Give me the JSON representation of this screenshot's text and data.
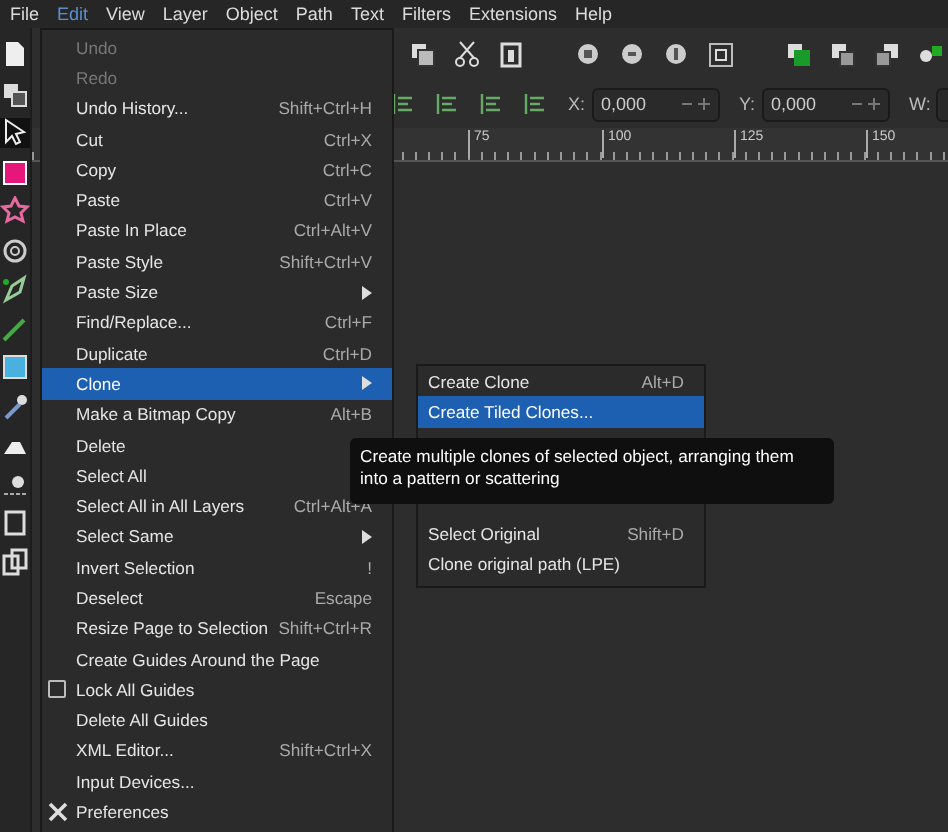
{
  "menubar": [
    {
      "label": "File",
      "selected": false
    },
    {
      "label": "Edit",
      "selected": true
    },
    {
      "label": "View",
      "selected": false
    },
    {
      "label": "Layer",
      "selected": false
    },
    {
      "label": "Object",
      "selected": false
    },
    {
      "label": "Path",
      "selected": false
    },
    {
      "label": "Text",
      "selected": false
    },
    {
      "label": "Filters",
      "selected": false
    },
    {
      "label": "Extensions",
      "selected": false
    },
    {
      "label": "Help",
      "selected": false
    }
  ],
  "controls_bar": {
    "fields": [
      {
        "label": "X:",
        "value": "0,000"
      },
      {
        "label": "Y:",
        "value": "0,000"
      },
      {
        "label": "W:"
      }
    ]
  },
  "ruler": {
    "labels": [
      "75",
      "100",
      "125",
      "150"
    ]
  },
  "edit_menu": {
    "items": [
      {
        "kind": "item",
        "label": "Undo",
        "disabled": true,
        "selected": false
      },
      {
        "kind": "item",
        "label": "Redo",
        "disabled": true,
        "selected": false
      },
      {
        "kind": "item",
        "label": "Undo History...",
        "shortcut": "Shift+Ctrl+H",
        "disabled": false,
        "selected": false
      },
      {
        "kind": "item",
        "label": "Cut",
        "shortcut": "Ctrl+X",
        "disabled": false,
        "selected": false
      },
      {
        "kind": "item",
        "label": "Copy",
        "shortcut": "Ctrl+C",
        "disabled": false,
        "selected": false
      },
      {
        "kind": "item",
        "label": "Paste",
        "shortcut": "Ctrl+V",
        "disabled": false,
        "selected": false
      },
      {
        "kind": "item",
        "label": "Paste In Place",
        "shortcut": "Ctrl+Alt+V",
        "disabled": false,
        "selected": false
      },
      {
        "kind": "item",
        "label": "Paste Style",
        "shortcut": "Shift+Ctrl+V",
        "disabled": false,
        "selected": false
      },
      {
        "kind": "submenu",
        "label": "Paste Size",
        "disabled": false,
        "selected": false
      },
      {
        "kind": "item",
        "label": "Find/Replace...",
        "shortcut": "Ctrl+F",
        "disabled": false,
        "selected": false
      },
      {
        "kind": "item",
        "label": "Duplicate",
        "shortcut": "Ctrl+D",
        "disabled": false,
        "selected": false
      },
      {
        "kind": "submenu",
        "label": "Clone",
        "disabled": false,
        "selected": true
      },
      {
        "kind": "item",
        "label": "Make a Bitmap Copy",
        "shortcut": "Alt+B",
        "disabled": false,
        "selected": false
      },
      {
        "kind": "item",
        "label": "Delete",
        "disabled": false,
        "selected": false
      },
      {
        "kind": "item",
        "label": "Select All",
        "disabled": false,
        "selected": false
      },
      {
        "kind": "item",
        "label": "Select All in All Layers",
        "shortcut": "Ctrl+Alt+A",
        "disabled": false,
        "selected": false
      },
      {
        "kind": "submenu",
        "label": "Select Same",
        "disabled": false,
        "selected": false
      },
      {
        "kind": "item",
        "label": "Invert Selection",
        "shortcut": "!",
        "disabled": false,
        "selected": false
      },
      {
        "kind": "item",
        "label": "Deselect",
        "shortcut": "Escape",
        "disabled": false,
        "selected": false
      },
      {
        "kind": "item",
        "label": "Resize Page to Selection",
        "shortcut": "Shift+Ctrl+R",
        "disabled": false,
        "selected": false
      },
      {
        "kind": "item",
        "label": "Create Guides Around the Page",
        "disabled": false,
        "selected": false
      },
      {
        "kind": "check",
        "label": "Lock All Guides",
        "checked": false,
        "disabled": false,
        "selected": false
      },
      {
        "kind": "item",
        "label": "Delete All Guides",
        "disabled": false,
        "selected": false
      },
      {
        "kind": "item",
        "label": "XML Editor...",
        "shortcut": "Shift+Ctrl+X",
        "disabled": false,
        "selected": false
      },
      {
        "kind": "item",
        "label": "Input Devices...",
        "disabled": false,
        "selected": false
      },
      {
        "kind": "icon",
        "label": "Preferences",
        "disabled": false,
        "selected": false
      }
    ]
  },
  "clone_submenu": {
    "items": [
      {
        "kind": "item",
        "label": "Create Clone",
        "shortcut": "Alt+D",
        "selected": false
      },
      {
        "kind": "item",
        "label": "Create Tiled Clones...",
        "selected": true
      },
      {
        "kind": "hidden"
      },
      {
        "kind": "hidden"
      },
      {
        "kind": "hidden"
      },
      {
        "kind": "item",
        "label": "Select Original",
        "shortcut": "Shift+D",
        "selected": false
      },
      {
        "kind": "item",
        "label": "Clone original path (LPE)",
        "selected": false
      }
    ]
  },
  "tooltip": {
    "text": "Create multiple clones of selected object, arranging them into a pattern or scattering"
  }
}
